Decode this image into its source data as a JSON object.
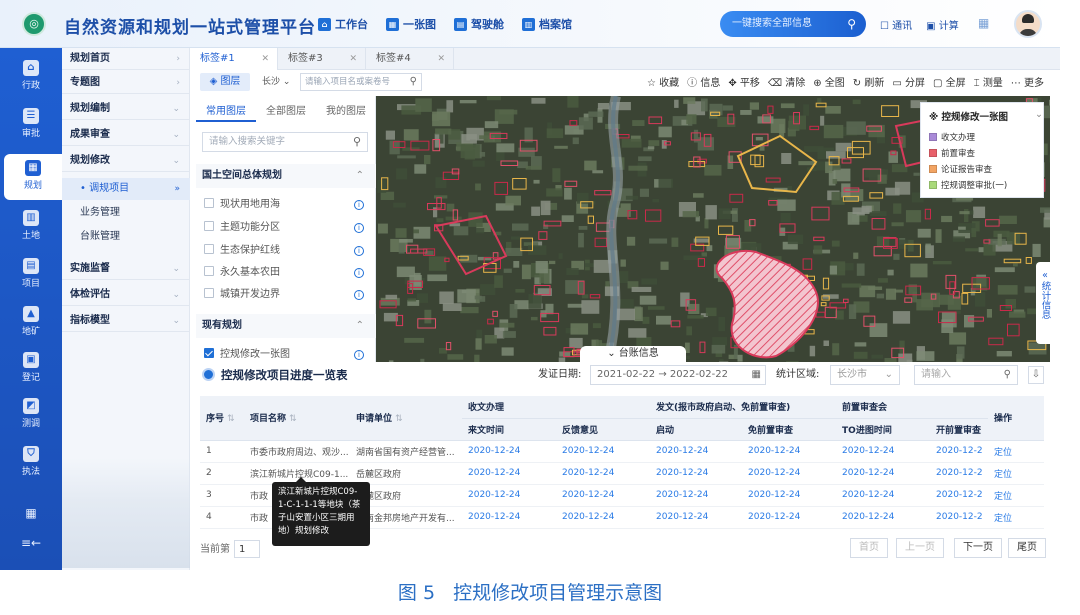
{
  "header": {
    "title": "自然资源和规划一站式管理平台",
    "nav": [
      {
        "label": "工作台",
        "icon": "workbench-icon"
      },
      {
        "label": "一张图",
        "icon": "map-icon"
      },
      {
        "label": "驾驶舱",
        "icon": "cockpit-icon"
      },
      {
        "label": "档案馆",
        "icon": "archive-icon"
      }
    ],
    "search_placeholder": "一键搜索全部信息",
    "tools": [
      "通讯",
      "计算"
    ],
    "accent": "#1f5fd2"
  },
  "rail": {
    "items": [
      {
        "label": "行政",
        "icon": "admin-icon"
      },
      {
        "label": "审批",
        "icon": "approval-icon"
      },
      {
        "label": "规划",
        "icon": "planning-icon",
        "active": true
      },
      {
        "label": "土地",
        "icon": "land-icon"
      },
      {
        "label": "项目",
        "icon": "project-icon"
      },
      {
        "label": "地矿",
        "icon": "mining-icon"
      },
      {
        "label": "登记",
        "icon": "register-icon"
      },
      {
        "label": "测调",
        "icon": "survey-icon"
      },
      {
        "label": "执法",
        "icon": "law-icon"
      }
    ]
  },
  "menu": {
    "groups": [
      "规划首页",
      "专题图",
      "规划编制",
      "成果审查",
      "规划修改"
    ],
    "sub_items": [
      "调规项目",
      "业务管理",
      "台账管理"
    ],
    "groups_after": [
      "实施监督",
      "体检评估",
      "指标模型"
    ]
  },
  "tabs": [
    "标签#1",
    "标签#3",
    "标签#4"
  ],
  "toolbar": {
    "layer_button": "图层",
    "city": "长沙",
    "project_search_placeholder": "请输入项目名或案卷号",
    "tools": [
      "收藏",
      "信息",
      "平移",
      "清除",
      "全图",
      "刷新",
      "分屏",
      "全屏",
      "测量",
      "更多"
    ]
  },
  "layer_panel": {
    "tabs": [
      "常用图层",
      "全部图层",
      "我的图层"
    ],
    "search_placeholder": "请输入搜索关键字",
    "sections": [
      {
        "title": "国土空间总体规划",
        "items": [
          "现状用地用海",
          "主题功能分区",
          "生态保护红线",
          "永久基本农田",
          "城镇开发边界"
        ]
      },
      {
        "title": "现有规划",
        "items": [
          "控规修改一张图"
        ]
      }
    ]
  },
  "legend": {
    "title": "控规修改一张图",
    "items": [
      {
        "label": "收文办理",
        "color": "#a98ad8"
      },
      {
        "label": "前置审查",
        "color": "#e8606a"
      },
      {
        "label": "论证报告审查",
        "color": "#f2a463"
      },
      {
        "label": "控规调整审批(一)",
        "color": "#a9d97a"
      }
    ]
  },
  "side_tab": "统计信息",
  "ledger_tab": "台账信息",
  "panel": {
    "title": "控规修改项目进度一览表",
    "date_label": "发证日期:",
    "date_from": "2021-02-22",
    "date_to": "2022-02-22",
    "region_label": "统计区域:",
    "region_value": "长沙市",
    "input_placeholder": "请输入",
    "group_headers": [
      "收文办理",
      "发文(报市政府启动、免前置审查)",
      "前置审查会"
    ],
    "columns": [
      "序号",
      "项目名称",
      "申请单位",
      "来文时间",
      "反馈意见",
      "启动",
      "免前置审查",
      "TO进图时间",
      "开前置审查",
      "操作"
    ],
    "rows": [
      [
        "1",
        "市委市政府周边、观沙...",
        "湖南省国有资产经营管...",
        "2020-12-24",
        "2020-12-24",
        "2020-12-24",
        "2020-12-24",
        "2020-12-24",
        "2020-12-2",
        "定位"
      ],
      [
        "2",
        "滨江新城片控规C09-1...",
        "岳麓区政府",
        "2020-12-24",
        "2020-12-24",
        "2020-12-24",
        "2020-12-24",
        "2020-12-24",
        "2020-12-2",
        "定位"
      ],
      [
        "3",
        "市政",
        "岳麓区政府",
        "2020-12-24",
        "2020-12-24",
        "2020-12-24",
        "2020-12-24",
        "2020-12-24",
        "2020-12-2",
        "定位"
      ],
      [
        "4",
        "市政",
        "湖南金邦房地产开发有...",
        "2020-12-24",
        "2020-12-24",
        "2020-12-24",
        "2020-12-24",
        "2020-12-24",
        "2020-12-2",
        "定位"
      ]
    ],
    "pager": {
      "current_label": "当前第",
      "current_value": "1",
      "first": "首页",
      "prev": "上一页",
      "next": "下一页",
      "last": "尾页"
    },
    "tooltip": "滨江新城片控规C09-1-C-1-1-1等地块（茶子山安置小区三期用地）规划修改"
  },
  "caption": {
    "figure": "图 5",
    "text": "控规修改项目管理示意图"
  }
}
